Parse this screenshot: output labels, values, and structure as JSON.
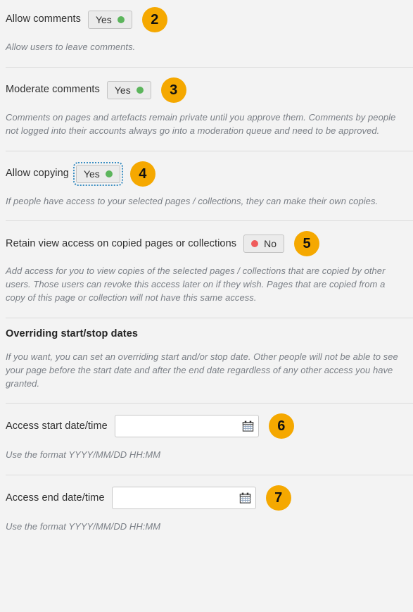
{
  "settings": [
    {
      "id": "allow-comments",
      "label": "Allow comments",
      "control": {
        "type": "toggle",
        "value": "Yes",
        "state": "yes",
        "focused": false
      },
      "badge": "2",
      "description": "Allow users to leave comments."
    },
    {
      "id": "moderate-comments",
      "label": "Moderate comments",
      "control": {
        "type": "toggle",
        "value": "Yes",
        "state": "yes",
        "focused": false
      },
      "badge": "3",
      "description": "Comments on pages and artefacts remain private until you approve them. Comments by people not logged into their accounts always go into a moderation queue and need to be approved."
    },
    {
      "id": "allow-copying",
      "label": "Allow copying",
      "control": {
        "type": "toggle",
        "value": "Yes",
        "state": "yes",
        "focused": true
      },
      "badge": "4",
      "description": "If people have access to your selected pages / collections, they can make their own copies."
    },
    {
      "id": "retain-view-access",
      "label": "Retain view access on copied pages or collections",
      "control": {
        "type": "toggle",
        "value": "No",
        "state": "no",
        "focused": false
      },
      "badge": "5",
      "description": "Add access for you to view copies of the selected pages / collections that are copied by other users. Those users can revoke this access later on if they wish. Pages that are copied from a copy of this page or collection will not have this same access."
    },
    {
      "id": "overriding-dates",
      "heading": "Overriding start/stop dates",
      "description": "If you want, you can set an overriding start and/or stop date. Other people will not be able to see your page before the start date and after the end date regardless of any other access you have granted."
    },
    {
      "id": "access-start",
      "label": "Access start date/time",
      "control": {
        "type": "date",
        "value": "",
        "placeholder": "",
        "icon": "calendar-icon"
      },
      "badge": "6",
      "description": "Use the format YYYY/MM/DD HH:MM"
    },
    {
      "id": "access-end",
      "label": "Access end date/time",
      "control": {
        "type": "date",
        "value": "",
        "placeholder": "",
        "icon": "calendar-icon"
      },
      "badge": "7",
      "description": "Use the format YYYY/MM/DD HH:MM"
    }
  ],
  "colors": {
    "page_background": "#f3f3f3",
    "badge_background": "#f5a800",
    "badge_text": "#111111",
    "yes_dot": "#5cb55c",
    "no_dot": "#ef5b5b",
    "divider": "#dcdcdc",
    "description_text": "#7a7f86",
    "focus_outline": "#3b8ec2"
  }
}
